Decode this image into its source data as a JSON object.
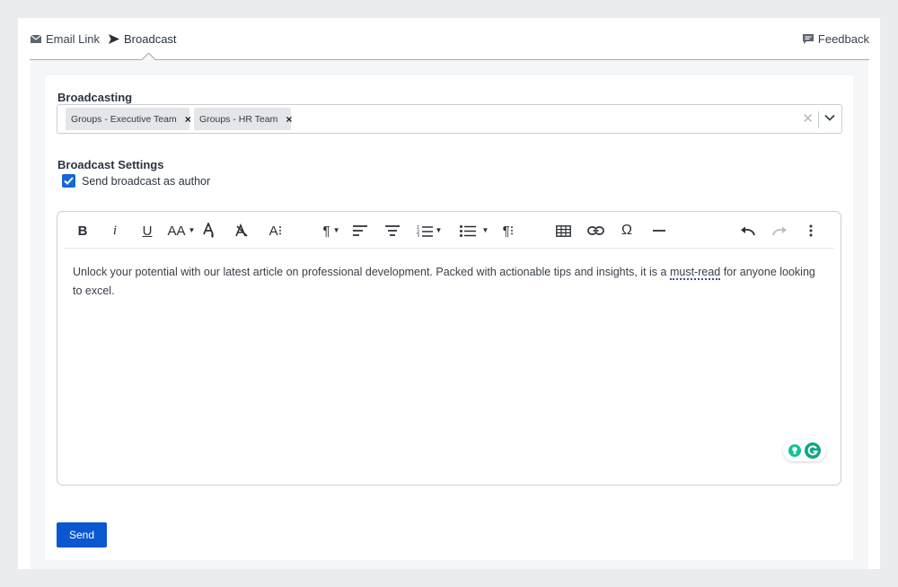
{
  "tabs": {
    "email_link": "Email Link",
    "broadcast": "Broadcast",
    "feedback": "Feedback"
  },
  "broadcasting": {
    "label": "Broadcasting",
    "selected": [
      "Groups - Executive Team",
      "Groups - HR Team"
    ]
  },
  "settings": {
    "label": "Broadcast Settings",
    "send_as_author_label": "Send broadcast as author",
    "send_as_author_checked": true
  },
  "editor": {
    "content_before": "Unlock your potential with our latest article on professional development. Packed with actionable tips and insights, it is a ",
    "content_flagged": "must-read",
    "content_after": " for anyone looking to excel.",
    "toolbar": {
      "bold": "B",
      "italic": "i",
      "underline": "U",
      "font_size": "AA",
      "font_family": "A⁝",
      "paragraph_format": "¶",
      "paragraph_style": "¶⁝",
      "special_chars": "Ω"
    }
  },
  "send_button": "Send",
  "colors": {
    "accent": "#0b57d0",
    "checkbox": "#1568d6",
    "grammarly": "#15c39a"
  }
}
